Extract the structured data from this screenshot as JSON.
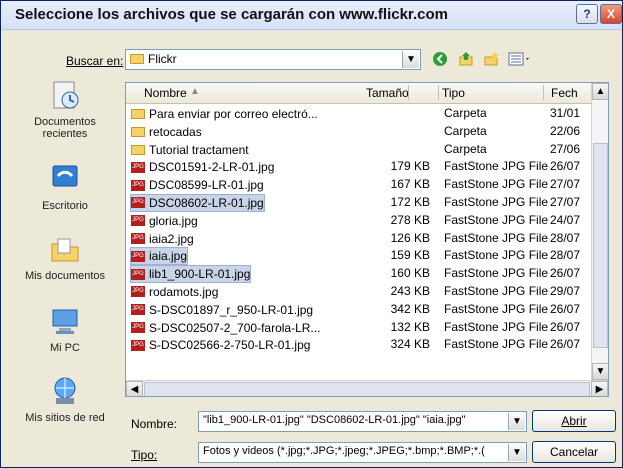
{
  "dialog": {
    "title": "Seleccione los archivos que se cargarán con www.flickr.com",
    "help_symbol": "?",
    "close_symbol": "X"
  },
  "lookin": {
    "label": "Buscar en:",
    "value": "Flickr"
  },
  "places": [
    {
      "label": "Documentos recientes",
      "icon": "recent-docs-icon"
    },
    {
      "label": "Escritorio",
      "icon": "desktop-icon"
    },
    {
      "label": "Mis documentos",
      "icon": "my-documents-icon"
    },
    {
      "label": "Mi PC",
      "icon": "my-computer-icon"
    },
    {
      "label": "Mis sitios de red",
      "icon": "network-places-icon"
    }
  ],
  "columns": [
    "Nombre",
    "Tamaño",
    "Tipo",
    "Fech"
  ],
  "files": [
    {
      "name": "Para enviar por correo electró...",
      "size": "",
      "type": "Carpeta",
      "date": "31/01",
      "icon": "folder",
      "selected": false
    },
    {
      "name": "retocadas",
      "size": "",
      "type": "Carpeta",
      "date": "22/06",
      "icon": "folder",
      "selected": false
    },
    {
      "name": "Tutorial tractament",
      "size": "",
      "type": "Carpeta",
      "date": "27/06",
      "icon": "folder",
      "selected": false
    },
    {
      "name": "DSC01591-2-LR-01.jpg",
      "size": "179 KB",
      "type": "FastStone JPG File",
      "date": "26/07",
      "icon": "jpg",
      "selected": false
    },
    {
      "name": "DSC08599-LR-01.jpg",
      "size": "167 KB",
      "type": "FastStone JPG File",
      "date": "27/07",
      "icon": "jpg",
      "selected": false
    },
    {
      "name": "DSC08602-LR-01.jpg",
      "size": "172 KB",
      "type": "FastStone JPG File",
      "date": "27/07",
      "icon": "jpg",
      "selected": true
    },
    {
      "name": "gloria.jpg",
      "size": "278 KB",
      "type": "FastStone JPG File",
      "date": "24/07",
      "icon": "jpg",
      "selected": false
    },
    {
      "name": "iaia2.jpg",
      "size": "126 KB",
      "type": "FastStone JPG File",
      "date": "28/07",
      "icon": "jpg",
      "selected": false
    },
    {
      "name": "iaia.jpg",
      "size": "159 KB",
      "type": "FastStone JPG File",
      "date": "28/07",
      "icon": "jpg",
      "selected": true
    },
    {
      "name": "lib1_900-LR-01.jpg",
      "size": "160 KB",
      "type": "FastStone JPG File",
      "date": "26/07",
      "icon": "jpg",
      "selected": true
    },
    {
      "name": "rodamots.jpg",
      "size": "243 KB",
      "type": "FastStone JPG File",
      "date": "29/07",
      "icon": "jpg",
      "selected": false
    },
    {
      "name": "S-DSC01897_r_950-LR-01.jpg",
      "size": "342 KB",
      "type": "FastStone JPG File",
      "date": "26/07",
      "icon": "jpg",
      "selected": false
    },
    {
      "name": "S-DSC02507-2_700-farola-LR...",
      "size": "132 KB",
      "type": "FastStone JPG File",
      "date": "26/07",
      "icon": "jpg",
      "selected": false
    },
    {
      "name": "S-DSC02566-2-750-LR-01.jpg",
      "size": "324 KB",
      "type": "FastStone JPG File",
      "date": "26/07",
      "icon": "jpg",
      "selected": false
    }
  ],
  "footer": {
    "name_label": "Nombre:",
    "name_value": "\"lib1_900-LR-01.jpg\" \"DSC08602-LR-01.jpg\" \"iaia.jpg\"",
    "type_label": "Tipo:",
    "type_value": "Fotos y videos (*.jpg;*.JPG;*.jpeg;*.JPEG;*.bmp;*.BMP;*.(",
    "open_label": "Abrir",
    "cancel_label": "Cancelar"
  },
  "colors": {
    "selection": "#c9d4e8",
    "border": "#7f9db9"
  }
}
